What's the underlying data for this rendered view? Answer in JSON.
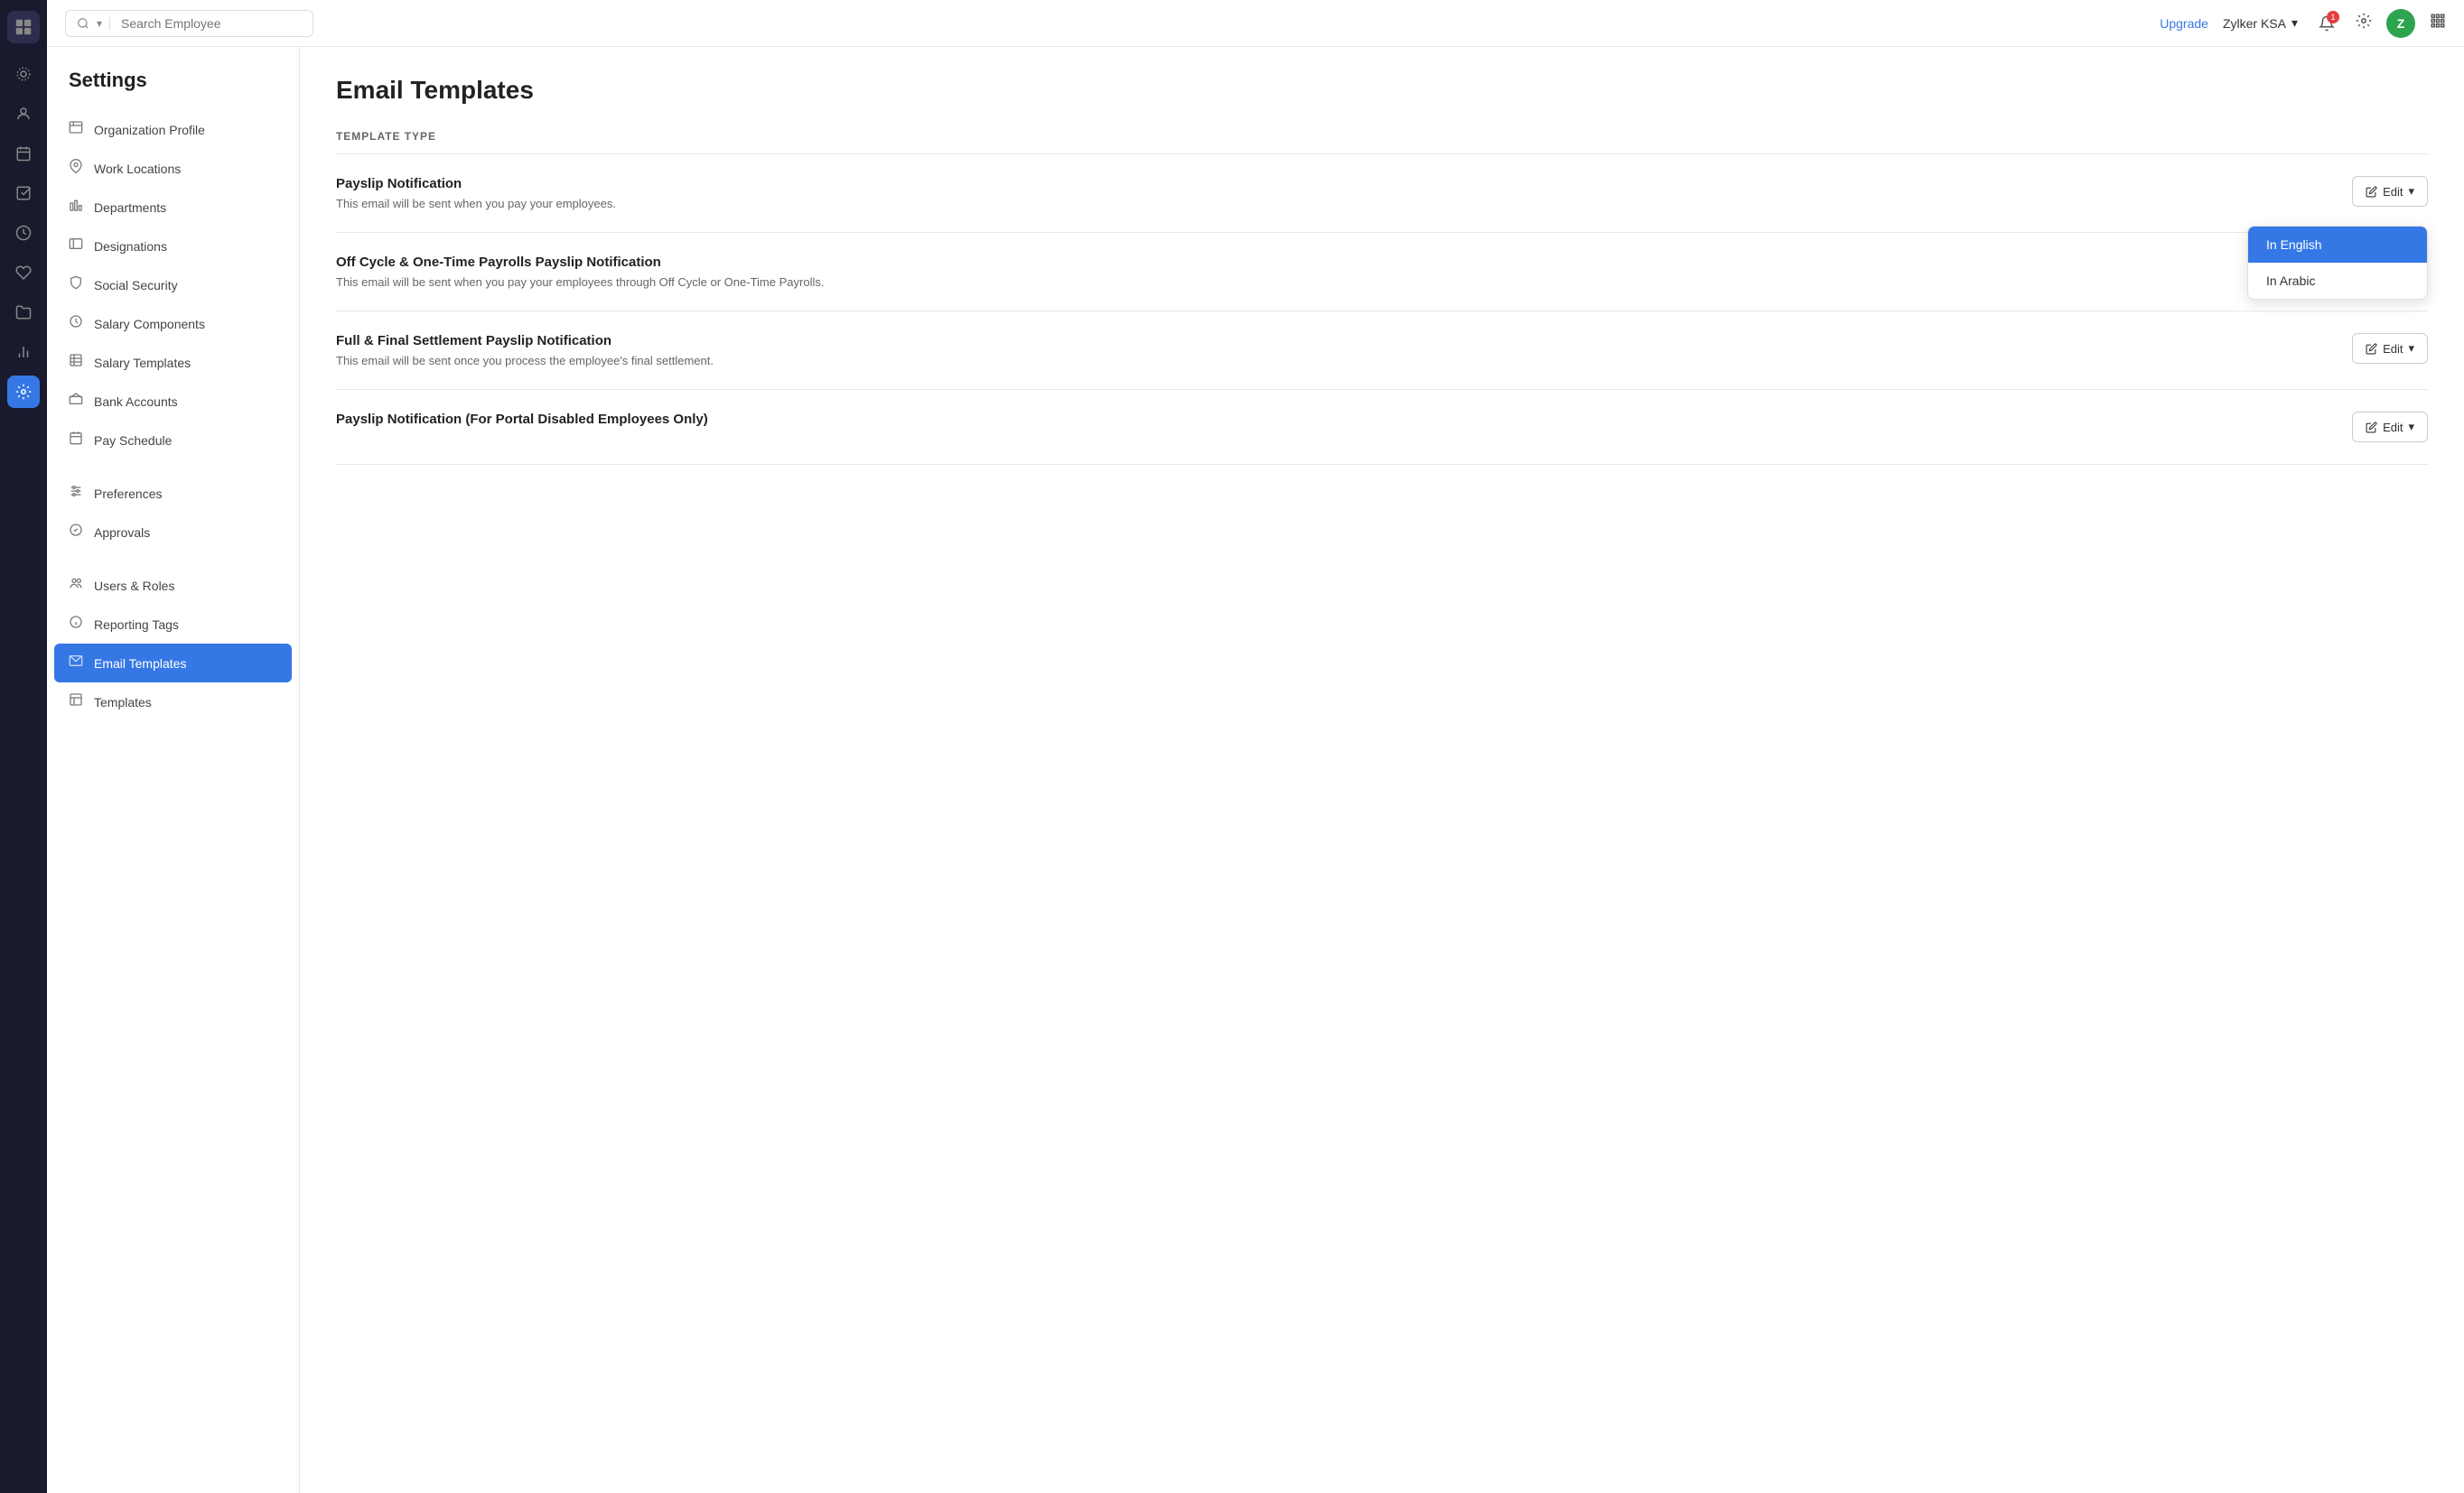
{
  "nav": {
    "logo_icon": "☰",
    "items": [
      {
        "id": "home",
        "icon": "⊙",
        "label": "home-icon",
        "active": false
      },
      {
        "id": "people",
        "icon": "👤",
        "label": "people-icon",
        "active": false
      },
      {
        "id": "calendar",
        "icon": "📅",
        "label": "calendar-icon",
        "active": false
      },
      {
        "id": "checklist",
        "icon": "☑",
        "label": "checklist-icon",
        "active": false
      },
      {
        "id": "bag",
        "icon": "💼",
        "label": "bag-icon",
        "active": false
      },
      {
        "id": "heart",
        "icon": "♡",
        "label": "heart-icon",
        "active": false
      },
      {
        "id": "folder",
        "icon": "📁",
        "label": "folder-icon",
        "active": false
      },
      {
        "id": "chart",
        "icon": "📊",
        "label": "chart-icon",
        "active": false
      },
      {
        "id": "settings",
        "icon": "⚙",
        "label": "settings-icon",
        "active": true
      }
    ]
  },
  "topbar": {
    "search_placeholder": "Search Employee",
    "upgrade_label": "Upgrade",
    "org_name": "Zylker KSA",
    "notification_count": "1",
    "avatar_letter": "Z"
  },
  "sidebar": {
    "title": "Settings",
    "items": [
      {
        "id": "org-profile",
        "label": "Organization Profile",
        "icon": "🏢"
      },
      {
        "id": "work-locations",
        "label": "Work Locations",
        "icon": "📍"
      },
      {
        "id": "departments",
        "label": "Departments",
        "icon": "🏛"
      },
      {
        "id": "designations",
        "label": "Designations",
        "icon": "🪪"
      },
      {
        "id": "social-security",
        "label": "Social Security",
        "icon": "🛡"
      },
      {
        "id": "salary-components",
        "label": "Salary Components",
        "icon": "💰"
      },
      {
        "id": "salary-templates",
        "label": "Salary Templates",
        "icon": "📋"
      },
      {
        "id": "bank-accounts",
        "label": "Bank Accounts",
        "icon": "🏦"
      },
      {
        "id": "pay-schedule",
        "label": "Pay Schedule",
        "icon": "📆"
      },
      {
        "id": "preferences",
        "label": "Preferences",
        "icon": "⚙"
      },
      {
        "id": "approvals",
        "label": "Approvals",
        "icon": "✅"
      },
      {
        "id": "users-roles",
        "label": "Users & Roles",
        "icon": "👥"
      },
      {
        "id": "reporting-tags",
        "label": "Reporting Tags",
        "icon": "🏷"
      },
      {
        "id": "email-templates",
        "label": "Email Templates",
        "icon": "✉",
        "active": true
      },
      {
        "id": "templates",
        "label": "Templates",
        "icon": "📄"
      }
    ]
  },
  "main": {
    "title": "Email Templates",
    "column_header": "TEMPLATE TYPE",
    "templates": [
      {
        "id": "payslip-notification",
        "title": "Payslip Notification",
        "description": "This email will be sent when you pay your employees.",
        "show_dropdown": true,
        "edit_label": "Edit"
      },
      {
        "id": "off-cycle",
        "title": "Off Cycle & One-Time Payrolls Payslip Notification",
        "description": "This email will be sent when you pay your employees through Off Cycle or One-Time Payrolls.",
        "show_dropdown": false,
        "edit_label": "Edit"
      },
      {
        "id": "full-final",
        "title": "Full & Final Settlement Payslip Notification",
        "description": "This email will be sent once you process the employee's final settlement.",
        "show_dropdown": false,
        "edit_label": "Edit"
      },
      {
        "id": "portal-disabled",
        "title": "Payslip Notification (For Portal Disabled Employees Only)",
        "description": "",
        "show_dropdown": false,
        "edit_label": "Edit"
      }
    ],
    "dropdown": {
      "options": [
        {
          "label": "In English",
          "selected": true
        },
        {
          "label": "In Arabic",
          "selected": false
        }
      ]
    }
  }
}
